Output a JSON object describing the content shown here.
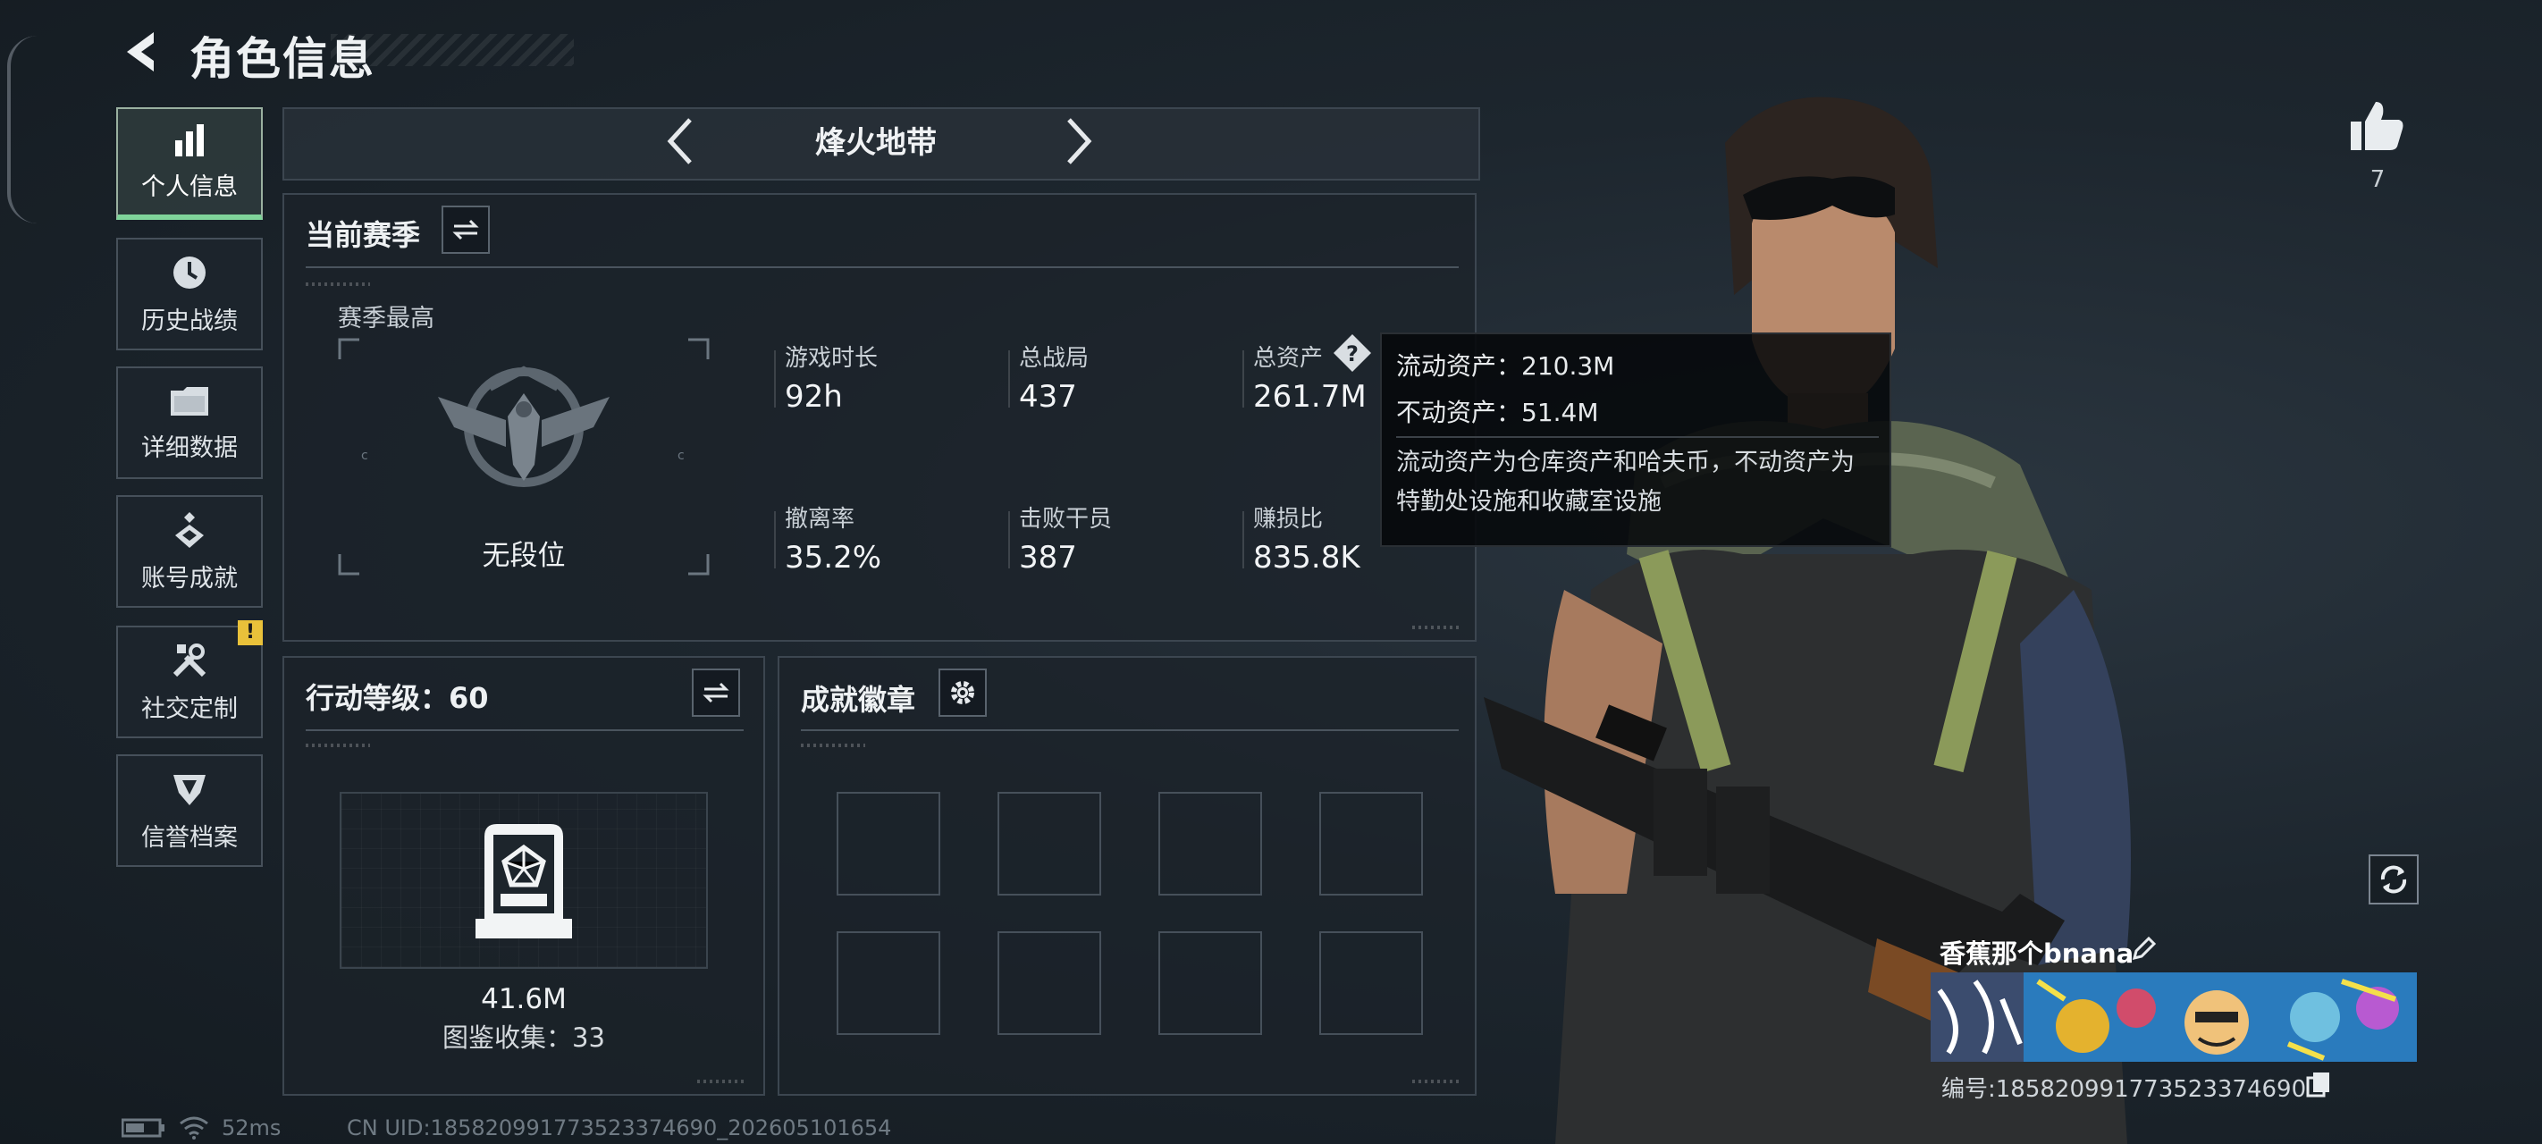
{
  "header": {
    "title": "角色信息"
  },
  "sidebar": {
    "items": [
      {
        "label": "个人信息",
        "icon": "bar-chart-icon",
        "active": true
      },
      {
        "label": "历史战绩",
        "icon": "clock-history-icon"
      },
      {
        "label": "详细数据",
        "icon": "folder-icon"
      },
      {
        "label": "账号成就",
        "icon": "achievement-icon"
      },
      {
        "label": "社交定制",
        "icon": "tools-icon",
        "badge": "!"
      },
      {
        "label": "信誉档案",
        "icon": "shield-emblem-icon"
      }
    ]
  },
  "mode": {
    "name": "烽火地带"
  },
  "season": {
    "title": "当前赛季",
    "best_label": "赛季最高",
    "rank": "无段位",
    "stats": [
      {
        "label": "游戏时长",
        "value": "92h"
      },
      {
        "label": "总战局",
        "value": "437"
      },
      {
        "label": "总资产",
        "value": "261.7M",
        "help": "?"
      },
      {
        "label": "撤离率",
        "value": "35.2%"
      },
      {
        "label": "击败干员",
        "value": "387"
      },
      {
        "label": "赚损比",
        "value": "835.8K"
      }
    ]
  },
  "tooltip": {
    "liquid": "流动资产：210.3M",
    "fixed": "不动资产：51.4M",
    "note": "流动资产为仓库资产和哈夫币，不动资产为特勤处设施和收藏室设施"
  },
  "action": {
    "title": "行动等级：60",
    "value": "41.6M",
    "collection": "图鉴收集：33"
  },
  "badges": {
    "title": "成就徽章",
    "slots": 8
  },
  "profile": {
    "likes": "7",
    "name": "香蕉那个bnana",
    "id": "编号:185820991773523374690"
  },
  "status": {
    "ping": "52ms",
    "uid": "CN UID:185820991773523374690_202605101654"
  },
  "colors": {
    "accent": "#7fd49a",
    "badge": "#e9c13a",
    "panel_border": "#3c4650"
  }
}
